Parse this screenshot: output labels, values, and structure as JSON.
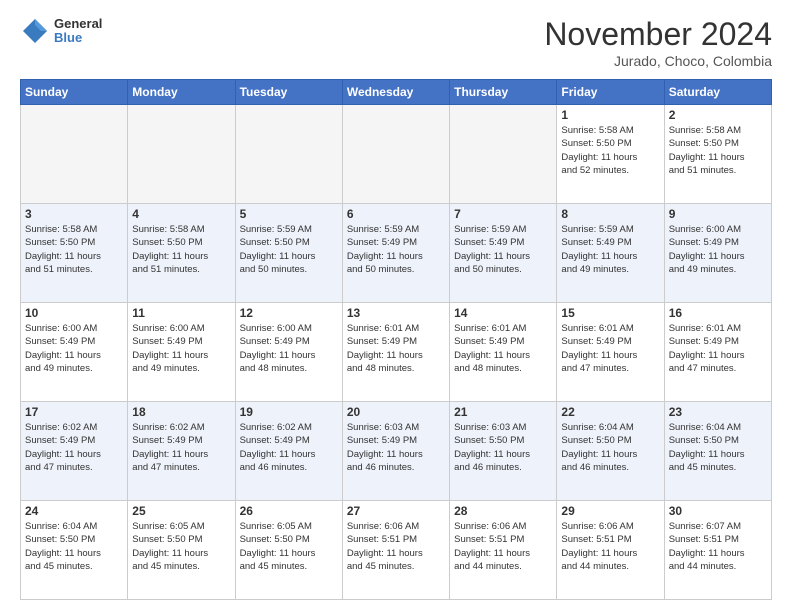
{
  "header": {
    "logo_general": "General",
    "logo_blue": "Blue",
    "month_title": "November 2024",
    "location": "Jurado, Choco, Colombia"
  },
  "weekdays": [
    "Sunday",
    "Monday",
    "Tuesday",
    "Wednesday",
    "Thursday",
    "Friday",
    "Saturday"
  ],
  "weeks": [
    [
      {
        "day": "",
        "info": ""
      },
      {
        "day": "",
        "info": ""
      },
      {
        "day": "",
        "info": ""
      },
      {
        "day": "",
        "info": ""
      },
      {
        "day": "",
        "info": ""
      },
      {
        "day": "1",
        "info": "Sunrise: 5:58 AM\nSunset: 5:50 PM\nDaylight: 11 hours\nand 52 minutes."
      },
      {
        "day": "2",
        "info": "Sunrise: 5:58 AM\nSunset: 5:50 PM\nDaylight: 11 hours\nand 51 minutes."
      }
    ],
    [
      {
        "day": "3",
        "info": "Sunrise: 5:58 AM\nSunset: 5:50 PM\nDaylight: 11 hours\nand 51 minutes."
      },
      {
        "day": "4",
        "info": "Sunrise: 5:58 AM\nSunset: 5:50 PM\nDaylight: 11 hours\nand 51 minutes."
      },
      {
        "day": "5",
        "info": "Sunrise: 5:59 AM\nSunset: 5:50 PM\nDaylight: 11 hours\nand 50 minutes."
      },
      {
        "day": "6",
        "info": "Sunrise: 5:59 AM\nSunset: 5:49 PM\nDaylight: 11 hours\nand 50 minutes."
      },
      {
        "day": "7",
        "info": "Sunrise: 5:59 AM\nSunset: 5:49 PM\nDaylight: 11 hours\nand 50 minutes."
      },
      {
        "day": "8",
        "info": "Sunrise: 5:59 AM\nSunset: 5:49 PM\nDaylight: 11 hours\nand 49 minutes."
      },
      {
        "day": "9",
        "info": "Sunrise: 6:00 AM\nSunset: 5:49 PM\nDaylight: 11 hours\nand 49 minutes."
      }
    ],
    [
      {
        "day": "10",
        "info": "Sunrise: 6:00 AM\nSunset: 5:49 PM\nDaylight: 11 hours\nand 49 minutes."
      },
      {
        "day": "11",
        "info": "Sunrise: 6:00 AM\nSunset: 5:49 PM\nDaylight: 11 hours\nand 49 minutes."
      },
      {
        "day": "12",
        "info": "Sunrise: 6:00 AM\nSunset: 5:49 PM\nDaylight: 11 hours\nand 48 minutes."
      },
      {
        "day": "13",
        "info": "Sunrise: 6:01 AM\nSunset: 5:49 PM\nDaylight: 11 hours\nand 48 minutes."
      },
      {
        "day": "14",
        "info": "Sunrise: 6:01 AM\nSunset: 5:49 PM\nDaylight: 11 hours\nand 48 minutes."
      },
      {
        "day": "15",
        "info": "Sunrise: 6:01 AM\nSunset: 5:49 PM\nDaylight: 11 hours\nand 47 minutes."
      },
      {
        "day": "16",
        "info": "Sunrise: 6:01 AM\nSunset: 5:49 PM\nDaylight: 11 hours\nand 47 minutes."
      }
    ],
    [
      {
        "day": "17",
        "info": "Sunrise: 6:02 AM\nSunset: 5:49 PM\nDaylight: 11 hours\nand 47 minutes."
      },
      {
        "day": "18",
        "info": "Sunrise: 6:02 AM\nSunset: 5:49 PM\nDaylight: 11 hours\nand 47 minutes."
      },
      {
        "day": "19",
        "info": "Sunrise: 6:02 AM\nSunset: 5:49 PM\nDaylight: 11 hours\nand 46 minutes."
      },
      {
        "day": "20",
        "info": "Sunrise: 6:03 AM\nSunset: 5:49 PM\nDaylight: 11 hours\nand 46 minutes."
      },
      {
        "day": "21",
        "info": "Sunrise: 6:03 AM\nSunset: 5:50 PM\nDaylight: 11 hours\nand 46 minutes."
      },
      {
        "day": "22",
        "info": "Sunrise: 6:04 AM\nSunset: 5:50 PM\nDaylight: 11 hours\nand 46 minutes."
      },
      {
        "day": "23",
        "info": "Sunrise: 6:04 AM\nSunset: 5:50 PM\nDaylight: 11 hours\nand 45 minutes."
      }
    ],
    [
      {
        "day": "24",
        "info": "Sunrise: 6:04 AM\nSunset: 5:50 PM\nDaylight: 11 hours\nand 45 minutes."
      },
      {
        "day": "25",
        "info": "Sunrise: 6:05 AM\nSunset: 5:50 PM\nDaylight: 11 hours\nand 45 minutes."
      },
      {
        "day": "26",
        "info": "Sunrise: 6:05 AM\nSunset: 5:50 PM\nDaylight: 11 hours\nand 45 minutes."
      },
      {
        "day": "27",
        "info": "Sunrise: 6:06 AM\nSunset: 5:51 PM\nDaylight: 11 hours\nand 45 minutes."
      },
      {
        "day": "28",
        "info": "Sunrise: 6:06 AM\nSunset: 5:51 PM\nDaylight: 11 hours\nand 44 minutes."
      },
      {
        "day": "29",
        "info": "Sunrise: 6:06 AM\nSunset: 5:51 PM\nDaylight: 11 hours\nand 44 minutes."
      },
      {
        "day": "30",
        "info": "Sunrise: 6:07 AM\nSunset: 5:51 PM\nDaylight: 11 hours\nand 44 minutes."
      }
    ]
  ]
}
